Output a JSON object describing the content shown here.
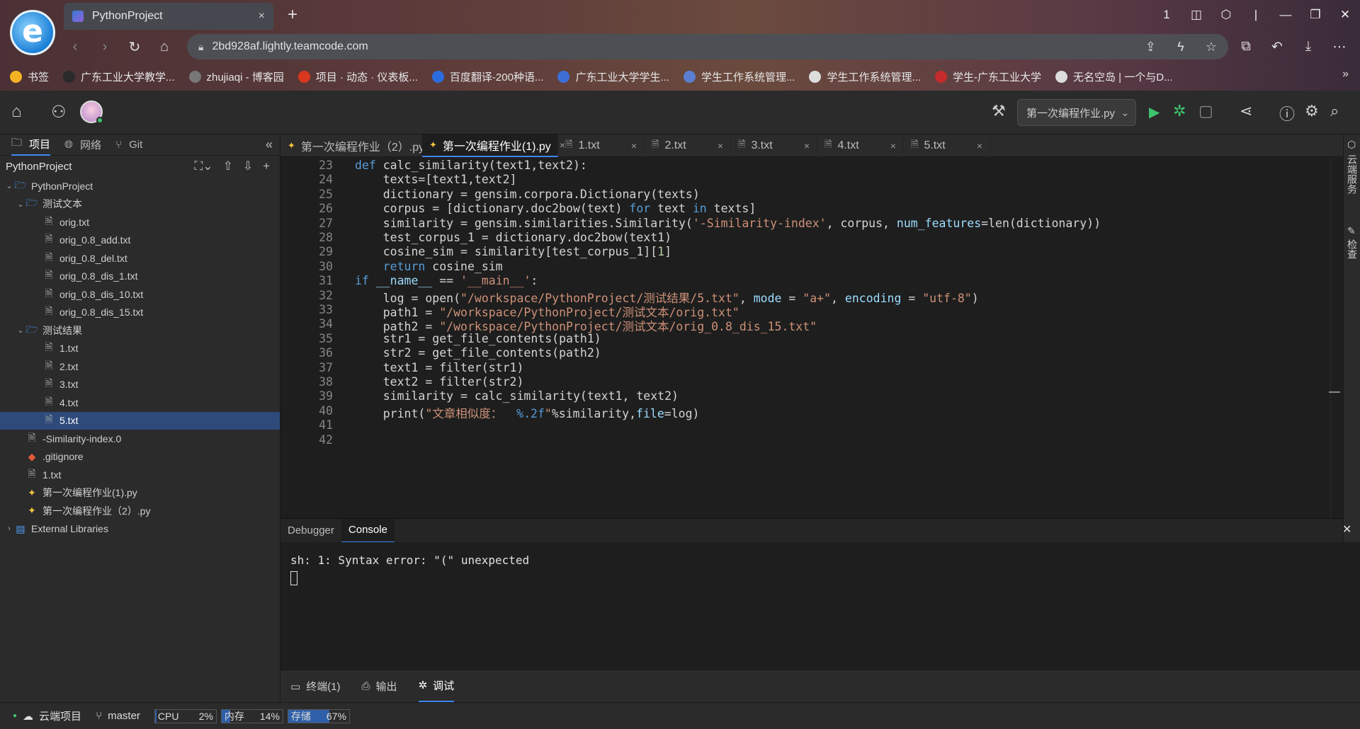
{
  "browser": {
    "tab_title": "PythonProject",
    "tab_close": "×",
    "new_tab": "+",
    "address": "2bd928af.lightly.teamcode.com",
    "logo_letter": "e",
    "window_controls": [
      "1",
      "◫",
      "⬡",
      "|",
      "—",
      "❐",
      "✕"
    ],
    "bookmarks": [
      {
        "label": "书签",
        "icon": "star-icon",
        "color": "#f5b323"
      },
      {
        "label": "广东工业大学教学...",
        "icon": "building-icon",
        "color": "#2a2a2a"
      },
      {
        "label": "zhujiaqi - 博客园",
        "icon": "blog-icon",
        "color": "#777777"
      },
      {
        "label": "项目 · 动态 · 仪表板...",
        "icon": "gitee-icon",
        "color": "#d9381e"
      },
      {
        "label": "百度翻译-200种语...",
        "icon": "translate-icon",
        "color": "#2b6de0"
      },
      {
        "label": "广东工业大学学生...",
        "icon": "m-icon",
        "color": "#3d6fd8"
      },
      {
        "label": "学生工作系统管理...",
        "icon": "seal-icon",
        "color": "#5b7fd0"
      },
      {
        "label": "学生工作系统管理...",
        "icon": "circle-icon",
        "color": "#dddddd"
      },
      {
        "label": "学生-广东工业大学",
        "icon": "seal-red-icon",
        "color": "#c62b2b"
      },
      {
        "label": "无名空岛 | 一个与D...",
        "icon": "bird-icon",
        "color": "#dddddd"
      }
    ],
    "bookmarks_more": "»"
  },
  "ide": {
    "run_config": "第一次编程作业.py",
    "sidebar_tabs": [
      "项目",
      "网络",
      "Git"
    ],
    "project_title": "PythonProject",
    "tree": [
      {
        "label": "PythonProject",
        "type": "folder",
        "depth": 0,
        "arrow": "⌄"
      },
      {
        "label": "测试文本",
        "type": "folder",
        "depth": 1,
        "arrow": "⌄"
      },
      {
        "label": "orig.txt",
        "type": "file",
        "depth": 2
      },
      {
        "label": "orig_0.8_add.txt",
        "type": "file",
        "depth": 2
      },
      {
        "label": "orig_0.8_del.txt",
        "type": "file",
        "depth": 2
      },
      {
        "label": "orig_0.8_dis_1.txt",
        "type": "file",
        "depth": 2
      },
      {
        "label": "orig_0.8_dis_10.txt",
        "type": "file",
        "depth": 2
      },
      {
        "label": "orig_0.8_dis_15.txt",
        "type": "file",
        "depth": 2
      },
      {
        "label": "测试结果",
        "type": "folder",
        "depth": 1,
        "arrow": "⌄"
      },
      {
        "label": "1.txt",
        "type": "file",
        "depth": 2
      },
      {
        "label": "2.txt",
        "type": "file",
        "depth": 2
      },
      {
        "label": "3.txt",
        "type": "file",
        "depth": 2
      },
      {
        "label": "4.txt",
        "type": "file",
        "depth": 2
      },
      {
        "label": "5.txt",
        "type": "file",
        "depth": 2,
        "selected": true
      },
      {
        "label": "-Similarity-index.0",
        "type": "file",
        "depth": 1
      },
      {
        "label": ".gitignore",
        "type": "git",
        "depth": 1
      },
      {
        "label": "1.txt",
        "type": "file",
        "depth": 1
      },
      {
        "label": "第一次编程作业(1).py",
        "type": "py",
        "depth": 1
      },
      {
        "label": "第一次编程作业（2）.py",
        "type": "py",
        "depth": 1
      },
      {
        "label": "External Libraries",
        "type": "lib",
        "depth": 0,
        "arrow": "›"
      }
    ],
    "editor_tabs": [
      {
        "label": "第一次编程作业（2）.py",
        "type": "py",
        "active": false,
        "close": "×"
      },
      {
        "label": "第一次编程作业(1).py",
        "type": "py",
        "active": true,
        "close": "×"
      },
      {
        "label": "1.txt",
        "type": "txt",
        "active": false,
        "close": "×"
      },
      {
        "label": "2.txt",
        "type": "txt",
        "active": false,
        "close": "×"
      },
      {
        "label": "3.txt",
        "type": "txt",
        "active": false,
        "close": "×"
      },
      {
        "label": "4.txt",
        "type": "txt",
        "active": false,
        "close": "×"
      },
      {
        "label": "5.txt",
        "type": "txt",
        "active": false,
        "close": "×"
      }
    ],
    "right_strip": [
      "云端服务",
      "检查"
    ],
    "code_lines": [
      {
        "n": "23",
        "tokens": [
          [
            "kw",
            "def "
          ],
          [
            "",
            "calc_similarity(text1,text2):"
          ]
        ]
      },
      {
        "n": "24",
        "tokens": [
          [
            "",
            "    texts=[text1,text2]"
          ]
        ]
      },
      {
        "n": "25",
        "tokens": [
          [
            "",
            "    dictionary = gensim.corpora.Dictionary(texts)"
          ]
        ]
      },
      {
        "n": "26",
        "tokens": [
          [
            "",
            "    corpus = [dictionary.doc2bow(text) "
          ],
          [
            "kw",
            "for"
          ],
          [
            "",
            " text "
          ],
          [
            "kw",
            "in"
          ],
          [
            "",
            " texts]"
          ]
        ]
      },
      {
        "n": "27",
        "tokens": [
          [
            "",
            "    similarity = gensim.similarities.Similarity("
          ],
          [
            "str",
            "'-Similarity-index'"
          ],
          [
            "",
            ", corpus, "
          ],
          [
            "par",
            "num_features"
          ],
          [
            "",
            "=len(dictionary))"
          ]
        ]
      },
      {
        "n": "28",
        "tokens": [
          [
            "",
            "    test_corpus_1 = dictionary.doc2bow(text1)"
          ]
        ]
      },
      {
        "n": "29",
        "tokens": [
          [
            "",
            "    cosine_sim = similarity[test_corpus_1]["
          ],
          [
            "num",
            "1"
          ],
          [
            "",
            "]"
          ]
        ]
      },
      {
        "n": "30",
        "tokens": [
          [
            "kw",
            "    return"
          ],
          [
            "",
            " cosine_sim"
          ]
        ]
      },
      {
        "n": "31",
        "tokens": [
          [
            "kw",
            "if"
          ],
          [
            "",
            " "
          ],
          [
            "par",
            "__name__"
          ],
          [
            "",
            " == "
          ],
          [
            "str",
            "'__main__'"
          ],
          [
            "",
            ":"
          ]
        ]
      },
      {
        "n": "32",
        "tokens": [
          [
            "",
            "    log = open("
          ],
          [
            "str",
            "\"/workspace/PythonProject/测试结果/5.txt\""
          ],
          [
            "",
            ", "
          ],
          [
            "par",
            "mode"
          ],
          [
            "",
            " = "
          ],
          [
            "str",
            "\"a+\""
          ],
          [
            "",
            ", "
          ],
          [
            "par",
            "encoding"
          ],
          [
            "",
            " = "
          ],
          [
            "str",
            "\"utf-8\""
          ],
          [
            "",
            ")"
          ]
        ]
      },
      {
        "n": "33",
        "tokens": [
          [
            "",
            "    path1 = "
          ],
          [
            "str",
            "\"/workspace/PythonProject/测试文本/orig.txt\""
          ]
        ]
      },
      {
        "n": "34",
        "tokens": [
          [
            "",
            "    path2 = "
          ],
          [
            "str",
            "\"/workspace/PythonProject/测试文本/orig_0.8_dis_15.txt\""
          ]
        ]
      },
      {
        "n": "35",
        "tokens": [
          [
            "",
            "    str1 = get_file_contents(path1)"
          ]
        ]
      },
      {
        "n": "36",
        "tokens": [
          [
            "",
            "    str2 = get_file_contents(path2)"
          ]
        ]
      },
      {
        "n": "37",
        "tokens": [
          [
            "",
            "    text1 = filter(str1)"
          ]
        ]
      },
      {
        "n": "38",
        "tokens": [
          [
            "",
            "    text2 = filter(str2)"
          ]
        ]
      },
      {
        "n": "39",
        "tokens": [
          [
            "",
            "    similarity = calc_similarity(text1, text2)"
          ]
        ]
      },
      {
        "n": "40",
        "tokens": [
          [
            "",
            "    print("
          ],
          [
            "str",
            "\"文章相似度： "
          ],
          [
            "kw",
            " %.2f"
          ],
          [
            "str",
            "\""
          ],
          [
            "",
            "%similarity,"
          ],
          [
            "par",
            "file"
          ],
          [
            "",
            "=log)"
          ]
        ]
      },
      {
        "n": "41",
        "tokens": [
          [
            "",
            ""
          ]
        ]
      },
      {
        "n": "42",
        "tokens": [
          [
            "",
            ""
          ]
        ]
      }
    ],
    "panel_tabs": [
      "Debugger",
      "Console"
    ],
    "panel_close": "✕",
    "console_output": "sh: 1: Syntax error: \"(\" unexpected",
    "bottom_tabs": [
      "终端(1)",
      "输出",
      "调试"
    ],
    "status": {
      "cloud": "云端项目",
      "branch": "master",
      "cpu_label": "CPU",
      "cpu_value": "2%",
      "cpu": 0.02,
      "mem_label": "内存",
      "mem_value": "14%",
      "mem": 0.14,
      "disk_label": "存储",
      "disk_value": "67%",
      "disk": 0.67
    }
  }
}
